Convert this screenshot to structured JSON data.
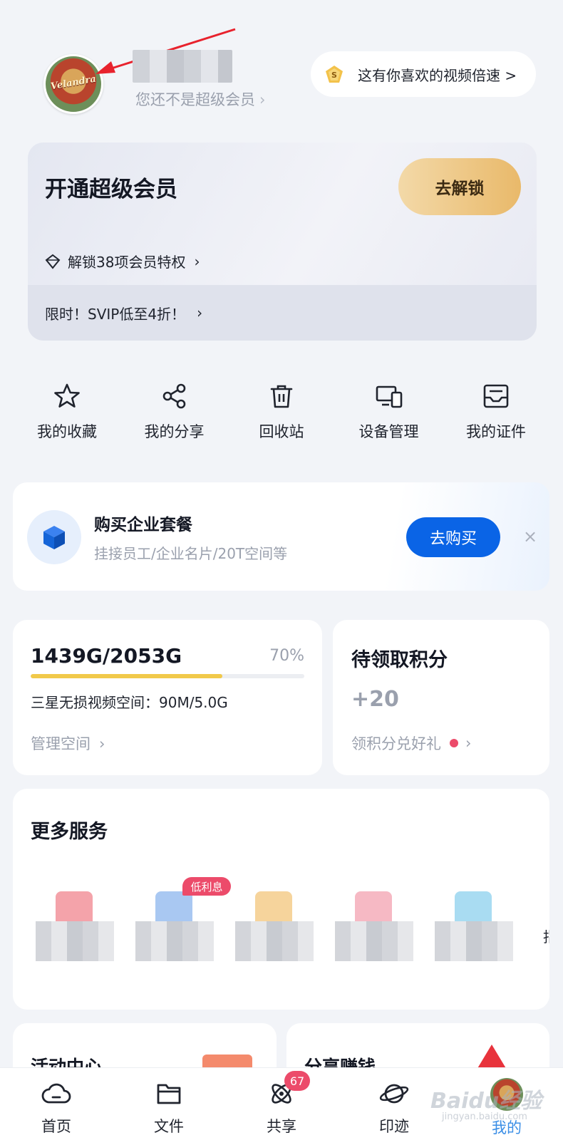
{
  "header": {
    "avatar_text": "Velandra",
    "member_status": "您还不是超级会员",
    "speed_promo": "这有你喜欢的视频倍速 >"
  },
  "vip": {
    "title": "开通超级会员",
    "button": "去解锁",
    "privileges": "解锁38项会员特权",
    "promo": "限时！SVIP低至4折！"
  },
  "actions": [
    {
      "label": "我的收藏",
      "icon": "star-icon"
    },
    {
      "label": "我的分享",
      "icon": "share-icon"
    },
    {
      "label": "回收站",
      "icon": "trash-icon"
    },
    {
      "label": "设备管理",
      "icon": "devices-icon"
    },
    {
      "label": "我的证件",
      "icon": "id-card-icon"
    }
  ],
  "enterprise": {
    "title": "购买企业套餐",
    "subtitle": "挂接员工/企业名片/20T空间等",
    "button": "去购买",
    "close": "×"
  },
  "storage": {
    "used": "1439G/2053G",
    "percent_label": "70%",
    "percent": 0.7,
    "extra": "三星无损视频空间：90M/5.0G",
    "manage": "管理空间"
  },
  "points": {
    "title": "待领取积分",
    "value": "+20",
    "link": "领积分兑好礼"
  },
  "services": {
    "title": "更多服务",
    "badge": "低利息",
    "edge_text": "指",
    "colors": [
      "#f4a3aa",
      "#a9c8f2",
      "#f6d49c",
      "#f6b9c4",
      "#a9dcf2"
    ]
  },
  "cards": {
    "activity": "活动中心",
    "share_earn": "分享赚钱"
  },
  "nav": {
    "items": [
      {
        "label": "首页",
        "icon": "cloud-icon"
      },
      {
        "label": "文件",
        "icon": "folder-icon"
      },
      {
        "label": "共享",
        "icon": "atom-icon",
        "badge": "67"
      },
      {
        "label": "印迹",
        "icon": "planet-icon"
      },
      {
        "label": "我的",
        "icon": "avatar"
      }
    ]
  },
  "watermark": {
    "logo": "Baidu经验",
    "url": "jingyan.baidu.com"
  },
  "colors": {
    "primary_blue": "#0a64e6",
    "vip_gold": "#e9b96a",
    "badge_red": "#ec4b6a",
    "progress_yellow": "#f1c94a",
    "active_tab": "#3a8ee6"
  }
}
